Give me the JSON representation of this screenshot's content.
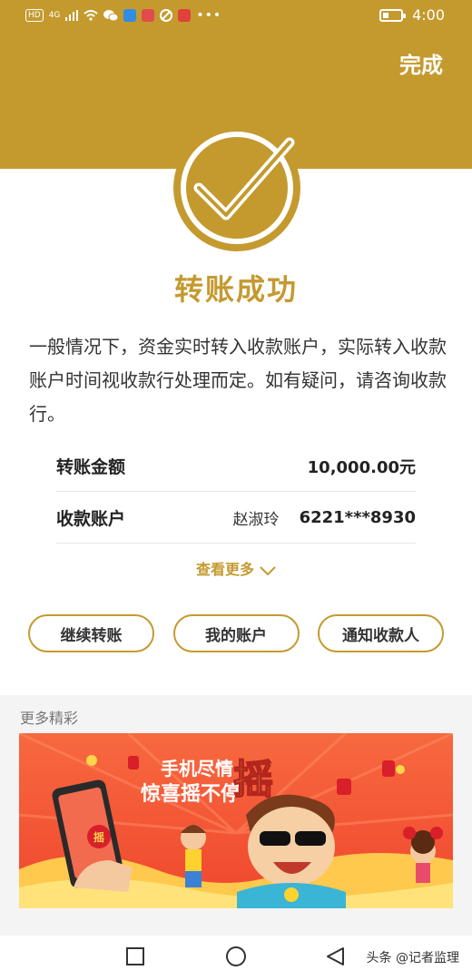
{
  "status_bar": {
    "hd_label": "HD",
    "network_label": "4G",
    "time": "4:00",
    "app_icons": [
      "signal-icon",
      "wifi-icon",
      "wechat-icon",
      "search-app-icon",
      "red-app-icon",
      "browser-icon",
      "vip-app-icon",
      "more-dots-icon"
    ]
  },
  "header": {
    "done_label": "完成",
    "accent_color": "#c49a2f"
  },
  "result": {
    "title": "转账成功",
    "description": "一般情况下，资金实时转入收款账户，实际转入收款账户时间视收款行处理而定。如有疑问，请咨询收款行。"
  },
  "details": {
    "amount_label": "转账金额",
    "amount_value": "10,000.00元",
    "account_label": "收款账户",
    "account_name": "赵淑玲",
    "account_number": "6221***8930"
  },
  "see_more_label": "查看更多",
  "actions": {
    "continue_label": "继续转账",
    "my_account_label": "我的账户",
    "notify_label": "通知收款人"
  },
  "more_section": {
    "title": "更多精彩",
    "banner_line1": "手机尽情",
    "banner_line2": "惊喜摇不停",
    "banner_big_char": "摇",
    "phone_badge": "摇"
  },
  "watermark": "头条 @记者监理"
}
